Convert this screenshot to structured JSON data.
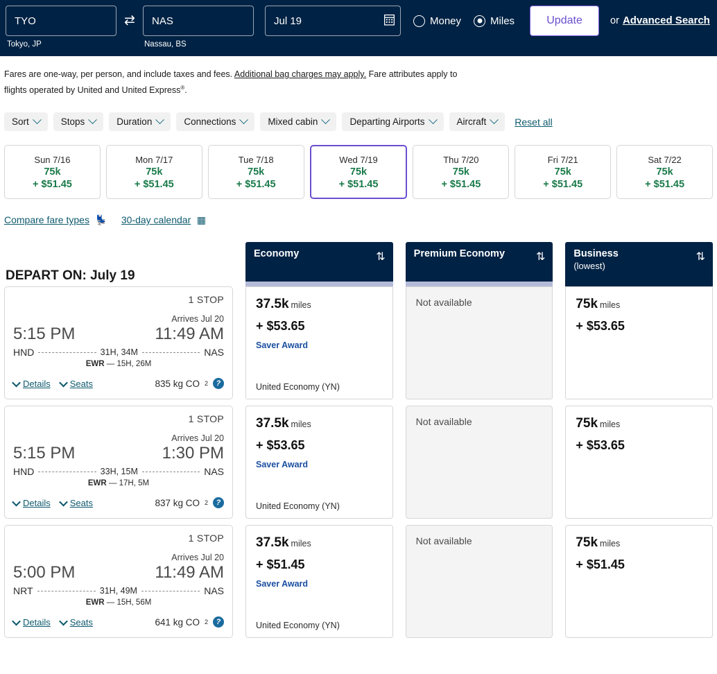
{
  "search": {
    "origin_value": "TYO",
    "origin_sub": "Tokyo, JP",
    "dest_value": "NAS",
    "dest_sub": "Nassau, BS",
    "date_value": "Jul 19",
    "swap_icon": "swap-arrows-icon",
    "calendar_icon": "calendar-icon",
    "money_label": "Money",
    "miles_label": "Miles",
    "selected_currency": "Miles",
    "update_label": "Update",
    "or_text": "or",
    "advanced_search_label": "Advanced Search",
    "accent_purple": "#6b4ecf",
    "bar_navy": "#002244"
  },
  "disclaimer": {
    "part1": "Fares are one-way, per person, and include taxes and fees. ",
    "link": "Additional bag charges may apply.",
    "part2": " Fare attributes apply to flights operated by United and United Express",
    "sup": "®",
    "part3": "."
  },
  "filters": {
    "chips": [
      {
        "label": "Sort"
      },
      {
        "label": "Stops"
      },
      {
        "label": "Duration"
      },
      {
        "label": "Connections"
      },
      {
        "label": "Mixed cabin"
      },
      {
        "label": "Departing Airports"
      },
      {
        "label": "Aircraft"
      }
    ],
    "reset_label": "Reset all"
  },
  "date_strip": [
    {
      "day": "Sun 7/16",
      "miles": "75k",
      "cash": "+ $51.45",
      "selected": false
    },
    {
      "day": "Mon 7/17",
      "miles": "75k",
      "cash": "+ $51.45",
      "selected": false
    },
    {
      "day": "Tue 7/18",
      "miles": "75k",
      "cash": "+ $51.45",
      "selected": false
    },
    {
      "day": "Wed 7/19",
      "miles": "75k",
      "cash": "+ $51.45",
      "selected": true
    },
    {
      "day": "Thu 7/20",
      "miles": "75k",
      "cash": "+ $51.45",
      "selected": false
    },
    {
      "day": "Fri 7/21",
      "miles": "75k",
      "cash": "+ $51.45",
      "selected": false
    },
    {
      "day": "Sat 7/22",
      "miles": "75k",
      "cash": "+ $51.45",
      "selected": false
    }
  ],
  "links": {
    "compare_label": "Compare fare types",
    "compare_icon": "seat-icon",
    "calendar_label": "30-day calendar",
    "calendar_icon": "calendar-grid-icon"
  },
  "results": {
    "depart_title": "DEPART ON: July 19",
    "columns": [
      {
        "title": "Economy",
        "sub": "",
        "sort_icon": "sort-updown-icon"
      },
      {
        "title": "Premium Economy",
        "sub": "",
        "sort_icon": "sort-updown-icon"
      },
      {
        "title": "Business",
        "sub": "(lowest)",
        "sort_icon": "sort-updown-icon"
      }
    ],
    "details_label": "Details",
    "seats_label": "Seats",
    "not_available_label": "Not available",
    "miles_unit": "miles",
    "flights": [
      {
        "stops": "1 STOP",
        "arrives": "Arrives Jul 20",
        "depart_time": "5:15 PM",
        "arrive_time": "11:49 AM",
        "origin": "HND",
        "destination": "NAS",
        "duration": "31H, 34M",
        "layover_airport": "EWR",
        "layover_duration": "15H, 26M",
        "co2": "835 kg CO",
        "co2_sub": "2",
        "fares": [
          {
            "available": true,
            "miles": "37.5k",
            "cash": "+ $53.65",
            "badge": "Saver Award",
            "cabin": "United Economy (YN)"
          },
          {
            "available": false
          },
          {
            "available": true,
            "miles": "75k",
            "cash": "+ $53.65",
            "badge": "",
            "cabin": ""
          }
        ]
      },
      {
        "stops": "1 STOP",
        "arrives": "Arrives Jul 20",
        "depart_time": "5:15 PM",
        "arrive_time": "1:30 PM",
        "origin": "HND",
        "destination": "NAS",
        "duration": "33H, 15M",
        "layover_airport": "EWR",
        "layover_duration": "17H, 5M",
        "co2": "837 kg CO",
        "co2_sub": "2",
        "fares": [
          {
            "available": true,
            "miles": "37.5k",
            "cash": "+ $53.65",
            "badge": "Saver Award",
            "cabin": "United Economy (YN)"
          },
          {
            "available": false
          },
          {
            "available": true,
            "miles": "75k",
            "cash": "+ $53.65",
            "badge": "",
            "cabin": ""
          }
        ]
      },
      {
        "stops": "1 STOP",
        "arrives": "Arrives Jul 20",
        "depart_time": "5:00 PM",
        "arrive_time": "11:49 AM",
        "origin": "NRT",
        "destination": "NAS",
        "duration": "31H, 49M",
        "layover_airport": "EWR",
        "layover_duration": "15H, 56M",
        "co2": "641 kg CO",
        "co2_sub": "2",
        "fares": [
          {
            "available": true,
            "miles": "37.5k",
            "cash": "+ $51.45",
            "badge": "Saver Award",
            "cabin": "United Economy (YN)"
          },
          {
            "available": false
          },
          {
            "available": true,
            "miles": "75k",
            "cash": "+ $51.45",
            "badge": "",
            "cabin": ""
          }
        ]
      }
    ]
  }
}
